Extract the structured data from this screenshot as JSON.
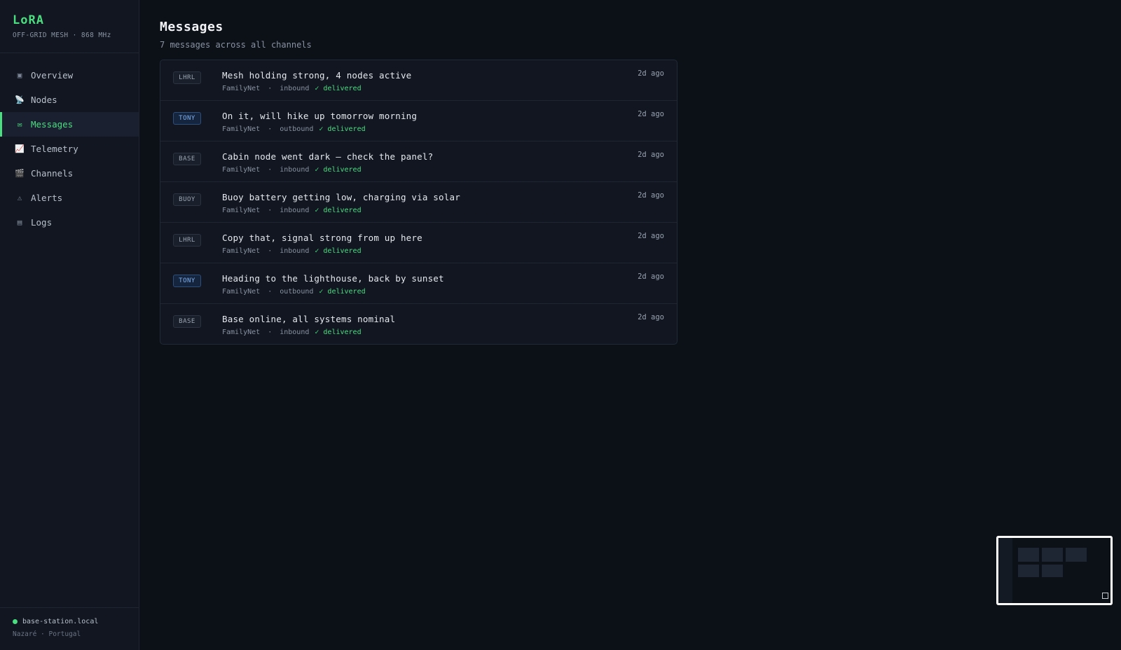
{
  "brand": {
    "title": "LoRA",
    "subtitle": "OFF-GRID MESH · 868 MHz"
  },
  "sidebar": {
    "items": [
      {
        "label": "Overview",
        "icon": "▣",
        "icon_name": "grid-icon",
        "active": false
      },
      {
        "label": "Nodes",
        "icon": "📡",
        "icon_name": "satellite-dish-icon",
        "active": false
      },
      {
        "label": "Messages",
        "icon": "✉",
        "icon_name": "envelope-icon",
        "active": true
      },
      {
        "label": "Telemetry",
        "icon": "📈",
        "icon_name": "chart-icon",
        "active": false
      },
      {
        "label": "Channels",
        "icon": "🎬",
        "icon_name": "clapperboard-icon",
        "active": false
      },
      {
        "label": "Alerts",
        "icon": "⚠",
        "icon_name": "warning-icon",
        "active": false
      },
      {
        "label": "Logs",
        "icon": "▤",
        "icon_name": "log-icon",
        "active": false
      }
    ]
  },
  "footer": {
    "station": "base-station.local",
    "location": "Nazaré · Portugal"
  },
  "page": {
    "title": "Messages",
    "subtitle": "7 messages across all channels"
  },
  "messages": [
    {
      "tag": "LHRL",
      "text": "Mesh holding strong, 4 nodes active",
      "channel": "FamilyNet",
      "direction": "inbound",
      "status": "✓ delivered",
      "time": "2d ago"
    },
    {
      "tag": "TONY",
      "text": "On it, will hike up tomorrow morning",
      "channel": "FamilyNet",
      "direction": "outbound",
      "status": "✓ delivered",
      "time": "2d ago"
    },
    {
      "tag": "BASE",
      "text": "Cabin node went dark — check the panel?",
      "channel": "FamilyNet",
      "direction": "inbound",
      "status": "✓ delivered",
      "time": "2d ago"
    },
    {
      "tag": "BUOY",
      "text": "Buoy battery getting low, charging via solar",
      "channel": "FamilyNet",
      "direction": "inbound",
      "status": "✓ delivered",
      "time": "2d ago"
    },
    {
      "tag": "LHRL",
      "text": "Copy that, signal strong from up here",
      "channel": "FamilyNet",
      "direction": "inbound",
      "status": "✓ delivered",
      "time": "2d ago"
    },
    {
      "tag": "TONY",
      "text": "Heading to the lighthouse, back by sunset",
      "channel": "FamilyNet",
      "direction": "outbound",
      "status": "✓ delivered",
      "time": "2d ago"
    },
    {
      "tag": "BASE",
      "text": "Base online, all systems nominal",
      "channel": "FamilyNet",
      "direction": "inbound",
      "status": "✓ delivered",
      "time": "2d ago"
    }
  ],
  "colors": {
    "accent": "#4ade80",
    "background": "#0c1017",
    "sidebar": "#111620",
    "outbound_tag": "#7fb0f0"
  }
}
